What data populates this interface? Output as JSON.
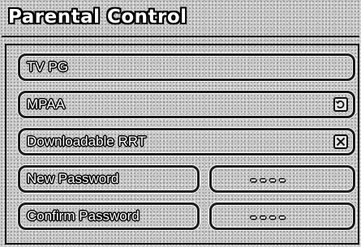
{
  "title": "Parental Control",
  "menu": {
    "tv_pg": "TV PG",
    "mpaa": "MPAA",
    "downloadable_rrt": "Downloadable RRT",
    "new_password": "New Password",
    "confirm_password": "Confirm Password"
  },
  "fields": {
    "new_password_value": "----",
    "confirm_password_value": "----"
  },
  "icons": {
    "mpaa_action": "cycle-icon",
    "rrt_action": "close-box-icon"
  }
}
